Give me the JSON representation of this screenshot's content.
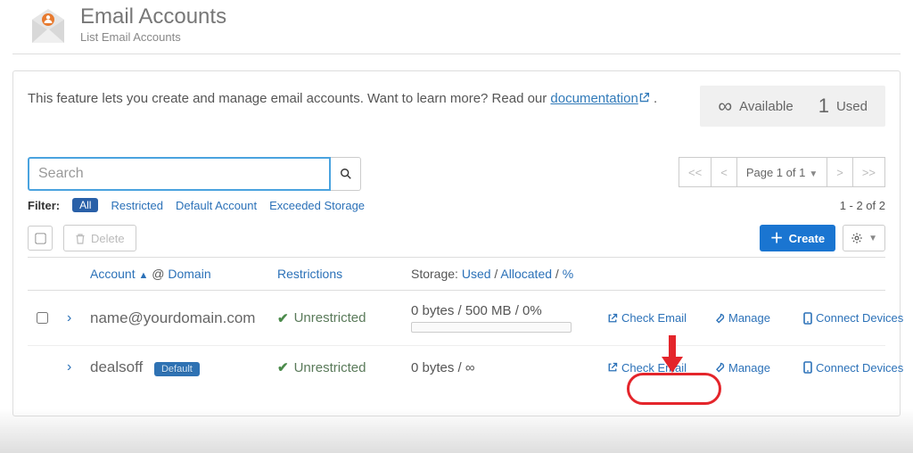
{
  "header": {
    "title": "Email Accounts",
    "subtitle": "List Email Accounts"
  },
  "intro": {
    "pre": "This feature lets you create and manage email accounts. Want to learn more? Read our ",
    "link": "documentation",
    "post": " ."
  },
  "stats": {
    "available_label": "Available",
    "available_value": "∞",
    "used_label": "Used",
    "used_value": "1"
  },
  "search": {
    "placeholder": "Search"
  },
  "pager": {
    "first": "<<",
    "prev": "<",
    "indicator": "Page 1 of 1",
    "next": ">",
    "last": ">>"
  },
  "filters": {
    "label": "Filter:",
    "all": "All",
    "restricted": "Restricted",
    "default": "Default Account",
    "exceeded": "Exceeded Storage"
  },
  "result_count": "1 - 2 of 2",
  "toolbar": {
    "delete": "Delete",
    "create": "Create"
  },
  "columns": {
    "account": "Account",
    "at": "@",
    "domain": "Domain",
    "restrictions": "Restrictions",
    "storage_label": "Storage:",
    "used": "Used",
    "allocated": "Allocated",
    "percent": "%"
  },
  "actions": {
    "check_email": "Check Email",
    "manage": "Manage",
    "connect": "Connect Devices"
  },
  "rows": [
    {
      "email": "name@yourdomain.com",
      "restriction": "Unrestricted",
      "storage": "0 bytes / 500 MB / 0%",
      "show_progress": true,
      "show_checkbox": true,
      "default": false
    },
    {
      "email": "dealsoff",
      "restriction": "Unrestricted",
      "storage": "0 bytes / ∞",
      "show_progress": false,
      "show_checkbox": false,
      "default": true,
      "default_label": "Default"
    }
  ]
}
